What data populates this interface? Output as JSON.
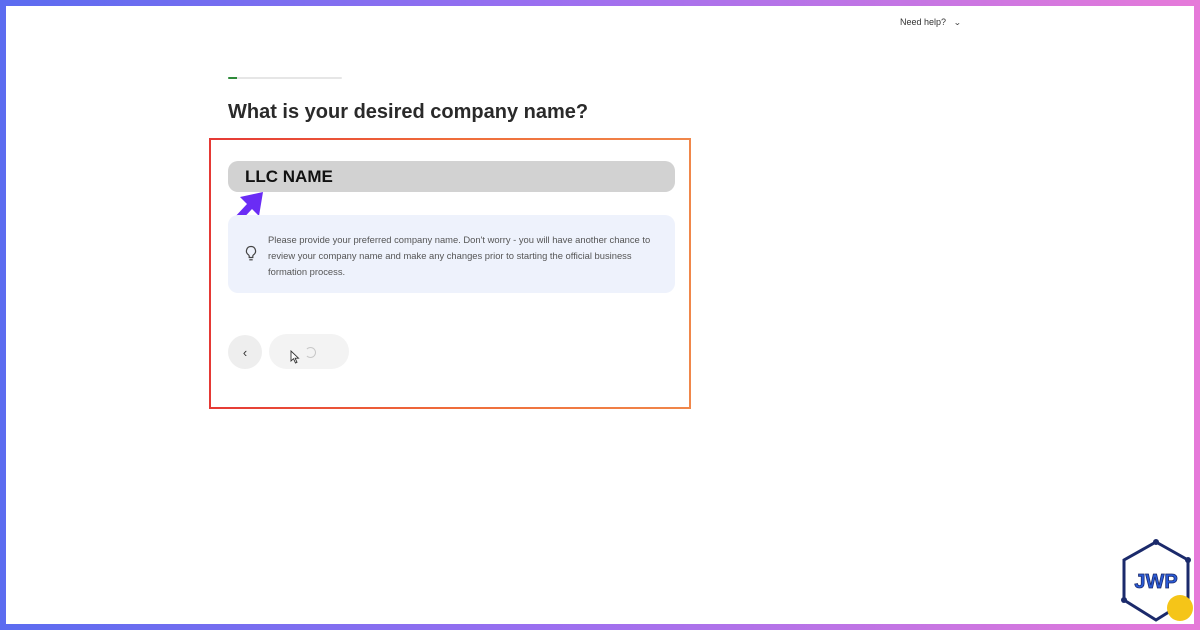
{
  "header": {
    "help_label": "Need help?",
    "help_icon": "chevron-down-icon"
  },
  "progress": {
    "fraction": 0.08,
    "color": "#2e8b3a"
  },
  "question": {
    "title": "What is your desired company name?"
  },
  "form": {
    "company_name_value": "LLC NAME",
    "tip_icon": "lightbulb-icon",
    "tip_text": "Please provide your preferred company name. Don't worry - you will have another chance to review your company name and make any changes prior to starting the official business formation process."
  },
  "navigation": {
    "back_icon": "chevron-left-icon",
    "next_state": "loading"
  },
  "annotation": {
    "highlight_color": "#e53935",
    "arrow_color": "#6a2cf5"
  },
  "branding": {
    "logo_text": "JWP"
  }
}
